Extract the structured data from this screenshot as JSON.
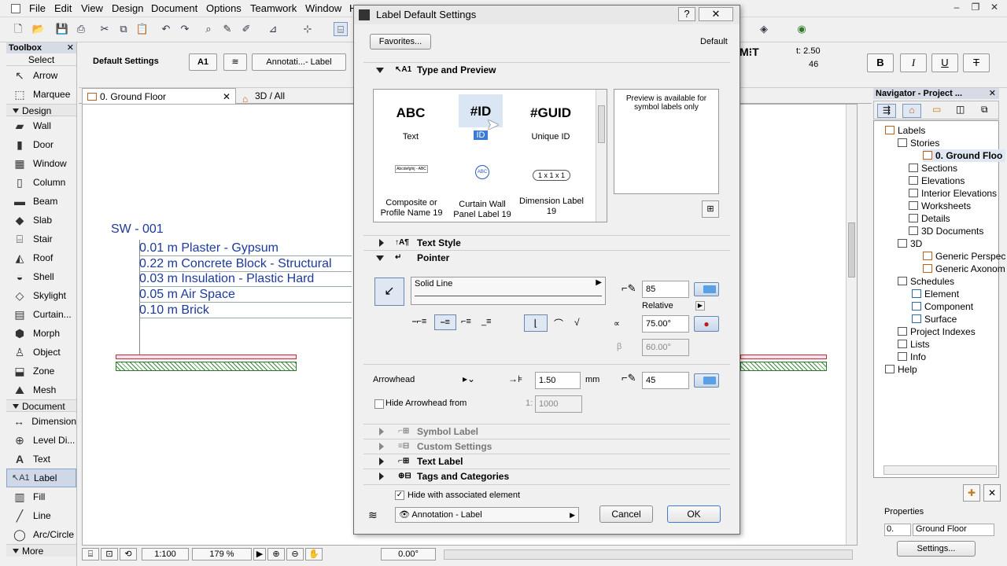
{
  "menubar": {
    "items": [
      "File",
      "Edit",
      "View",
      "Design",
      "Document",
      "Options",
      "Teamwork",
      "Window",
      "H"
    ]
  },
  "toolbox": {
    "title": "Toolbox",
    "select_label": "Select",
    "select_items": [
      "Arrow",
      "Marquee"
    ],
    "design_section": "Design",
    "design_items": [
      "Wall",
      "Door",
      "Window",
      "Column",
      "Beam",
      "Slab",
      "Stair",
      "Roof",
      "Shell",
      "Skylight",
      "Curtain...",
      "Morph",
      "Object",
      "Zone",
      "Mesh"
    ],
    "document_section": "Document",
    "document_items": [
      "Dimension",
      "Level Di...",
      "Text",
      "Label",
      "Fill",
      "Line",
      "Arc/Circle"
    ],
    "more_label": "More"
  },
  "infobox": {
    "default_settings": "Default Settings",
    "label_type": "A1",
    "layer": "Annotati...- Label",
    "text_size": "t: 2.50",
    "pen": "46",
    "bold": "B",
    "italic": "I",
    "underline": "U",
    "strike": "T"
  },
  "tabs": {
    "floor": "0. Ground Floor",
    "view3d": "3D / All"
  },
  "canvas": {
    "label_id": "SW - 001",
    "layers": [
      "0.01 m  Plaster - Gypsum",
      "0.22 m  Concrete Block - Structural",
      "0.03 m  Insulation - Plastic Hard",
      "0.05 m  Air Space",
      "0.10 m  Brick"
    ]
  },
  "bottombar": {
    "scale": "1:100",
    "zoom": "179 %",
    "angle": "0.00°"
  },
  "navigator": {
    "title": "Navigator - Project ...",
    "items": [
      "Labels",
      "Stories",
      "0. Ground Floo",
      "Sections",
      "Elevations",
      "Interior Elevations",
      "Worksheets",
      "Details",
      "3D Documents",
      "3D",
      "Generic Perspec",
      "Generic Axonom",
      "Schedules",
      "Element",
      "Component",
      "Surface",
      "Project Indexes",
      "Lists",
      "Info",
      "Help"
    ],
    "properties_label": "Properties",
    "prop_id": "0.",
    "prop_value": "Ground Floor",
    "settings_button": "Settings..."
  },
  "dialog": {
    "title": "Label Default Settings",
    "favorites_button": "Favorites...",
    "default_label": "Default",
    "sections": {
      "type_preview": "Type and Preview",
      "text_style": "Text Style",
      "pointer": "Pointer",
      "symbol_label": "Symbol Label",
      "custom_settings": "Custom Settings",
      "text_label": "Text Label",
      "tags_categories": "Tags and Categories"
    },
    "types": [
      {
        "glyph": "ABC",
        "name": "Text"
      },
      {
        "glyph": "#ID",
        "name": "ID"
      },
      {
        "glyph": "#GUID",
        "name": "Unique ID"
      },
      {
        "glyph": "Abcdefghij - ABC",
        "name": "Composite or Profile Name 19"
      },
      {
        "glyph": "ABC",
        "name": "Curtain Wall Panel Label 19"
      },
      {
        "glyph": "1 x 1 x 1",
        "name": "Dimension Label 19"
      }
    ],
    "preview_note": "Preview is available for symbol labels only",
    "pointer": {
      "line_type": "Solid Line",
      "pen": "85",
      "relative_label": "Relative",
      "angle": "75.00°",
      "beta": "60.00°",
      "beta_symbol": "β",
      "alpha_symbol": "∝"
    },
    "arrowhead": {
      "label": "Arrowhead",
      "size": "1.50",
      "unit": "mm",
      "pen": "45",
      "hide_from_label": "Hide Arrowhead from",
      "scale_prefix": "1:",
      "scale_value": "1000"
    },
    "hide_with_element": "Hide with associated element",
    "layer": "Annotation - Label",
    "cancel_button": "Cancel",
    "ok_button": "OK"
  }
}
